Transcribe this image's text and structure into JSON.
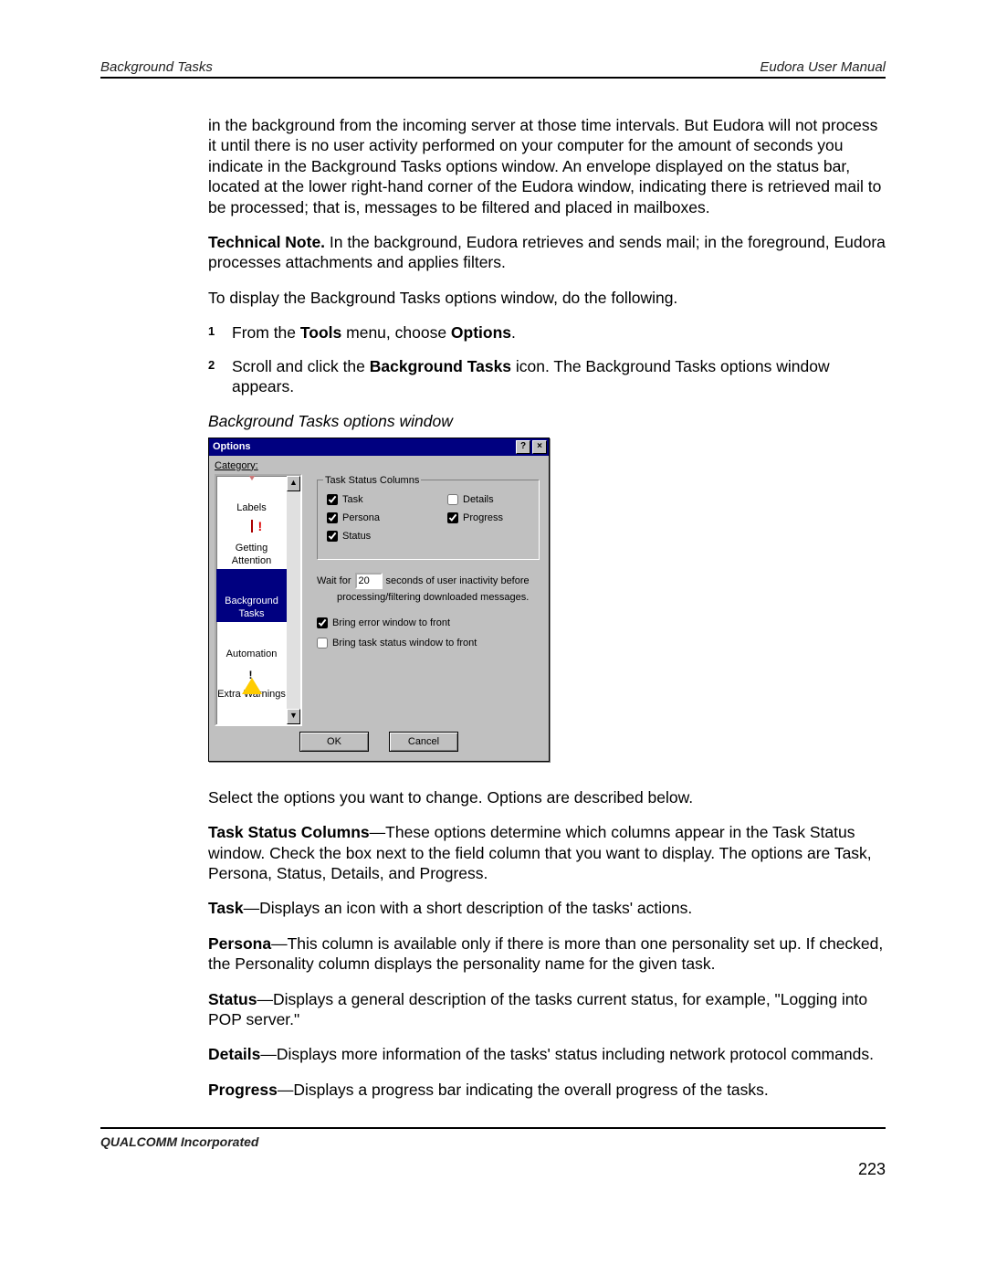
{
  "header": {
    "left": "Background Tasks",
    "right": "Eudora User Manual"
  },
  "para1": "in the background from the incoming server at those time intervals. But Eudora will not process it until there is no user activity performed on your computer for the amount of seconds you indicate in the Background Tasks options window. An envelope displayed on the status bar, located at the lower right-hand corner of the Eudora window, indicating there is retrieved mail to be processed; that is, messages to be filtered and placed in mailboxes.",
  "technote_label": "Technical Note.",
  "technote_text": " In the background, Eudora retrieves and sends mail; in the foreground, Eudora processes attachments and applies filters.",
  "para_display": " To display the Background Tasks options window, do the following.",
  "steps": [
    {
      "n": "1",
      "pre": "From the ",
      "b1": "Tools",
      "mid": " menu, choose ",
      "b2": "Options",
      "post": "."
    },
    {
      "n": "2",
      "pre": "Scroll and click the ",
      "b1": "Background Tasks",
      "mid": " icon. The Background Tasks options window appears.",
      "b2": "",
      "post": ""
    }
  ],
  "caption": "Background Tasks options window",
  "dialog": {
    "title": "Options",
    "category_label": "Category:",
    "categories": [
      "Labels",
      "Getting Attention",
      "Background Tasks",
      "Automation",
      "Extra Warnings"
    ],
    "selected_index": 2,
    "group_title": "Task Status Columns",
    "checks": {
      "task": {
        "label": "Task",
        "checked": true
      },
      "details": {
        "label": "Details",
        "checked": false
      },
      "persona": {
        "label": "Persona",
        "checked": true
      },
      "progress": {
        "label": "Progress",
        "checked": true
      },
      "status": {
        "label": "Status",
        "checked": true
      }
    },
    "wait_prefix": "Wait for",
    "wait_value": "20",
    "wait_suffix": "seconds of user inactivity before",
    "wait_line2": "processing/filtering downloaded messages.",
    "err_front": {
      "label": "Bring error window to front",
      "checked": true
    },
    "status_front": {
      "label": "Bring task status window to front",
      "checked": false
    },
    "ok": "OK",
    "cancel": "Cancel"
  },
  "after1": "Select the options you want to change. Options are described below.",
  "desc_tsc_b": "Task Status Columns",
  "desc_tsc": "—These options determine which columns appear in the Task Status window. Check the box next to the field column that you want to display. The options are Task, Persona, Status, Details, and Progress.",
  "d_task_b": "Task",
  "d_task": "—Displays an icon with a short description of the tasks' actions.",
  "d_persona_b": "Persona",
  "d_persona": "—This column is available only if there is more than one personality set up. If checked, the Personality column displays the personality name for the given task.",
  "d_status_b": "Status",
  "d_status": "—Displays a general description of the tasks current status, for example, \"Logging into POP server.\"",
  "d_details_b": "Details",
  "d_details": "—Displays more information of the tasks' status including network protocol commands.",
  "d_progress_b": "Progress",
  "d_progress": "—Displays a progress bar indicating the overall progress of the tasks.",
  "footer": {
    "company": "QUALCOMM Incorporated",
    "page": "223"
  }
}
